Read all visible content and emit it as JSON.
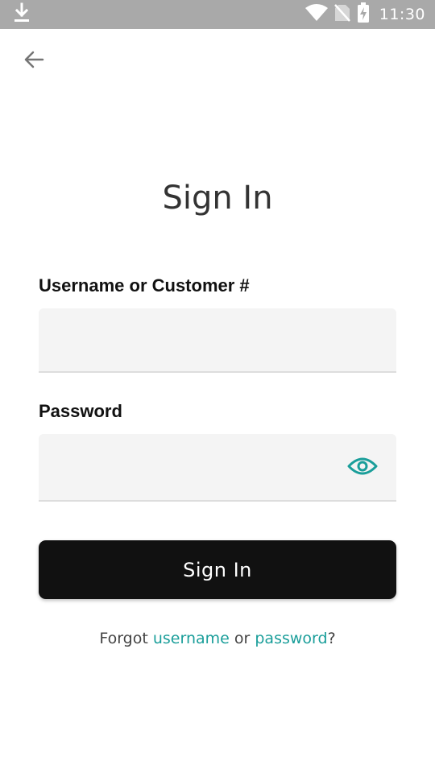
{
  "status_bar": {
    "time": "11:30",
    "icons": [
      "download-icon",
      "wifi-icon",
      "no-sim-icon",
      "battery-charging-icon"
    ]
  },
  "navigation": {
    "back_icon": "arrow-left-icon"
  },
  "page": {
    "title": "Sign In"
  },
  "form": {
    "username": {
      "label": "Username or Customer #",
      "value": "",
      "placeholder": ""
    },
    "password": {
      "label": "Password",
      "value": "",
      "placeholder": "",
      "toggle_icon": "eye-icon"
    },
    "submit_label": "Sign In"
  },
  "forgot": {
    "prefix": "Forgot ",
    "username_link": "username",
    "middle": " or ",
    "password_link": "password",
    "suffix": "?"
  },
  "colors": {
    "status_bar_bg": "#a9a9a9",
    "accent": "#1a9e9a",
    "button_bg": "#111111",
    "input_bg": "#f4f4f4"
  }
}
